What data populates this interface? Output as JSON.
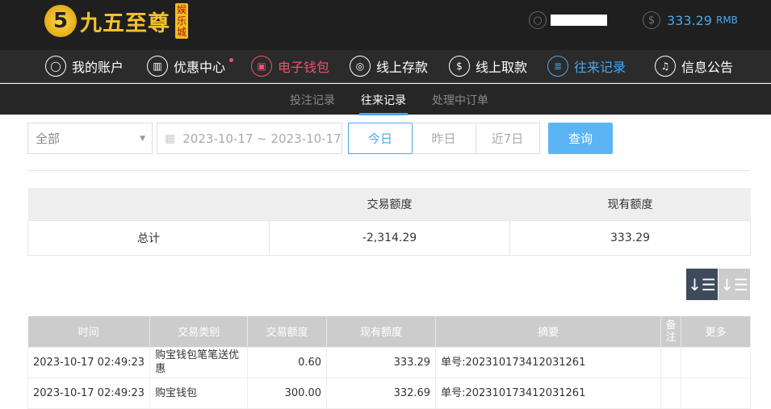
{
  "header": {
    "logo_text": "九五至尊",
    "logo_badge": "娱乐城",
    "logo_mark": "5",
    "balance": "333.29",
    "currency": "RMB"
  },
  "nav": [
    {
      "label": "我的账户",
      "icon": "user-icon"
    },
    {
      "label": "优惠中心",
      "icon": "gift-icon"
    },
    {
      "label": "电子钱包",
      "icon": "wallet-icon"
    },
    {
      "label": "线上存款",
      "icon": "deposit-icon"
    },
    {
      "label": "线上取款",
      "icon": "withdraw-icon"
    },
    {
      "label": "往来记录",
      "icon": "records-icon"
    },
    {
      "label": "信息公告",
      "icon": "bell-icon"
    }
  ],
  "subtabs": [
    "投注记录",
    "往来记录",
    "处理中订单"
  ],
  "filter": {
    "type": "全部",
    "date_range": "2023-10-17 ~ 2023-10-17",
    "today": "今日",
    "yesterday": "昨日",
    "week": "近7日",
    "query": "查询"
  },
  "summary": {
    "headers": [
      "",
      "交易额度",
      "现有额度"
    ],
    "row": [
      "总计",
      "-2,314.29",
      "333.29"
    ]
  },
  "table": {
    "headers": [
      "时间",
      "交易类别",
      "交易额度",
      "现有额度",
      "摘要",
      "备注",
      "更多"
    ],
    "rows": [
      [
        "2023-10-17 02:49:23",
        "购宝钱包笔笔送优惠",
        "0.60",
        "333.29",
        "单号:202310173412031261",
        "",
        ""
      ],
      [
        "2023-10-17 02:49:23",
        "购宝钱包",
        "300.00",
        "332.69",
        "单号:202310173412031261",
        "",
        ""
      ]
    ]
  }
}
